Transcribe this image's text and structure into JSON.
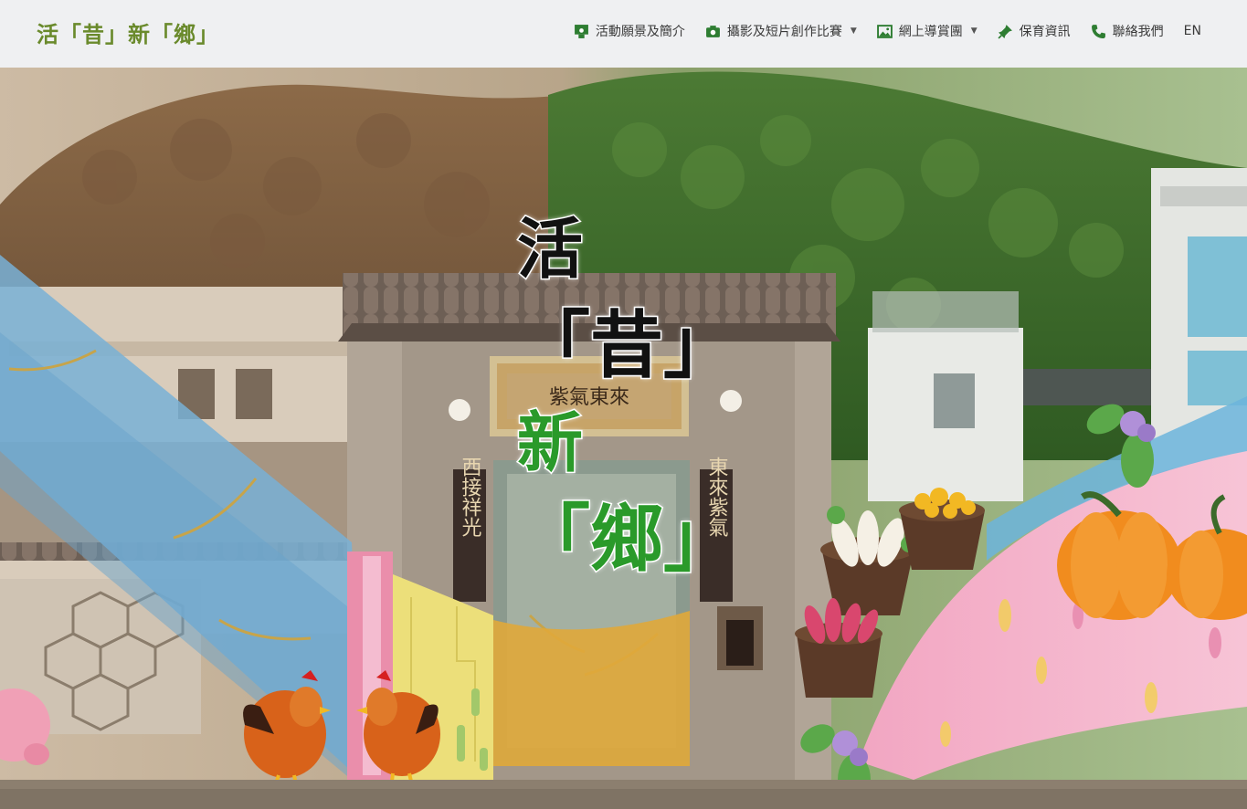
{
  "header": {
    "brand": "活「昔」新「鄉」",
    "nav": [
      {
        "label": "活動願景及簡介",
        "icon": "person-board-icon",
        "has_dropdown": false
      },
      {
        "label": "攝影及短片創作比賽",
        "icon": "camera-icon",
        "has_dropdown": true
      },
      {
        "label": "網上導賞團",
        "icon": "image-icon",
        "has_dropdown": true
      },
      {
        "label": "保育資訊",
        "icon": "pin-icon",
        "has_dropdown": false
      },
      {
        "label": "聯絡我們",
        "icon": "phone-icon",
        "has_dropdown": false
      }
    ],
    "lang": "EN",
    "dropdown_caret": "▼"
  },
  "hero": {
    "title_lines": [
      "活",
      "「昔」",
      "新",
      "「鄉」"
    ],
    "couplet_left": "西接祥光",
    "couplet_right": "東來紫氣",
    "plaque": "紫氣東來"
  },
  "colors": {
    "brand": "#6a8a2c",
    "accent_green": "#2a9a2a",
    "nav_icon": "#2e7d32",
    "header_bg": "#eff0f2"
  }
}
